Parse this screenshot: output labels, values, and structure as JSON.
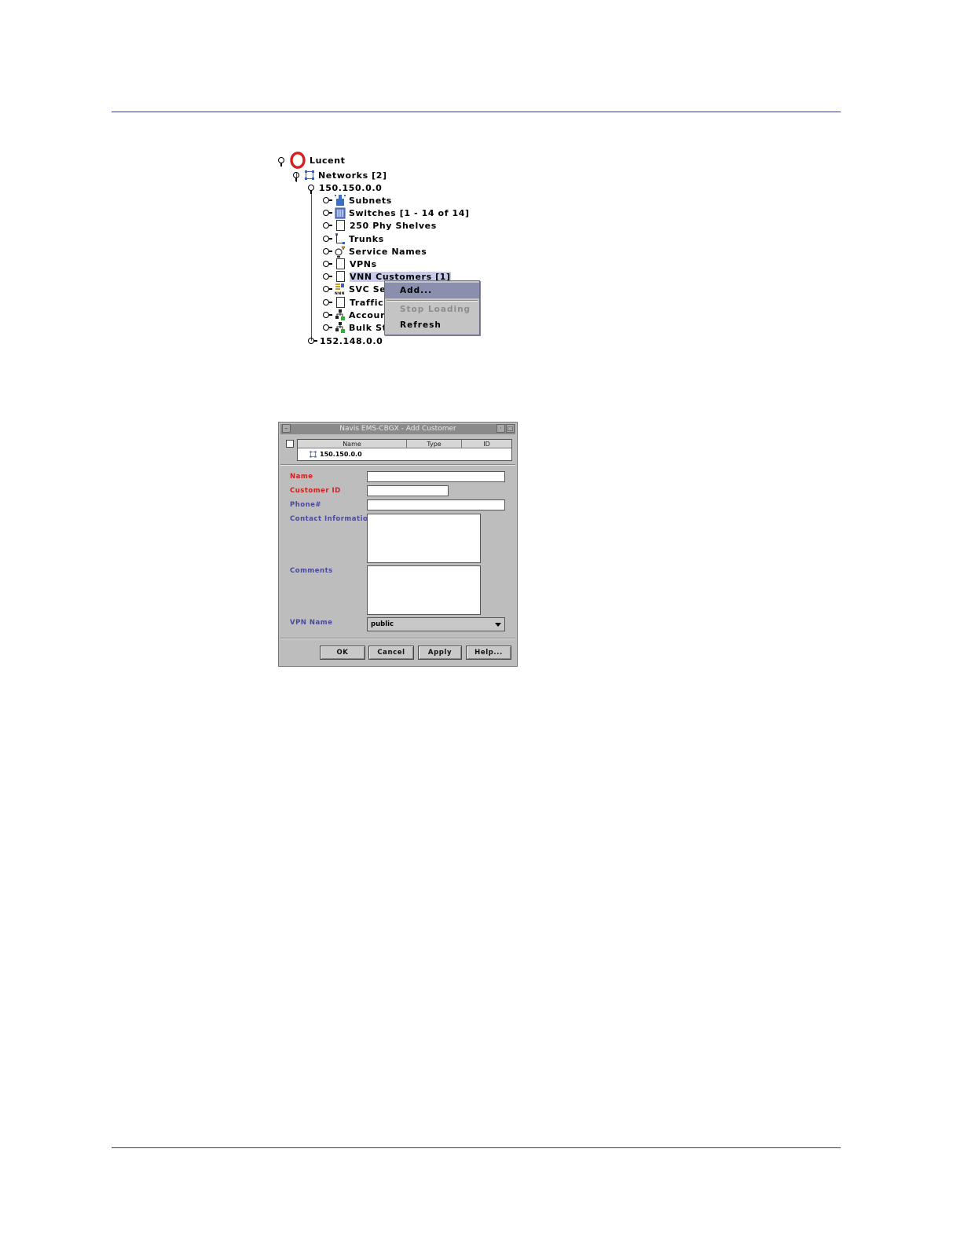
{
  "tree": {
    "root": "Lucent",
    "networks": "Networks [2]",
    "net1": "150.150.0.0",
    "children": [
      "Subnets",
      "Switches [1 - 14 of 14]",
      "250 Phy Shelves",
      "Trunks",
      "Service Names",
      "VPNs",
      "VNN Customers [1]",
      "SVC Se",
      "Traffic",
      "Accour",
      "Bulk St"
    ],
    "net2": "152.148.0.0"
  },
  "context_menu": {
    "items": [
      "Add...",
      "Stop Loading",
      "Refresh"
    ]
  },
  "dialog": {
    "title": "Navis EMS-CBGX - Add Customer",
    "table_headers": [
      "Name",
      "Type",
      "ID"
    ],
    "table_row_name": "150.150.0.0",
    "labels": {
      "name": "Name",
      "customer_id": "Customer ID",
      "phone": "Phone#",
      "contact": "Contact Information",
      "comments": "Comments",
      "vpn_name": "VPN Name"
    },
    "vpn_name_value": "public",
    "buttons": [
      "OK",
      "Cancel",
      "Apply",
      "Help..."
    ]
  },
  "colors": {
    "required_label": "#d02020",
    "optional_label": "#4a4a9a",
    "rule": "#3a3a7a",
    "menu_highlight": "#8a8fae"
  }
}
